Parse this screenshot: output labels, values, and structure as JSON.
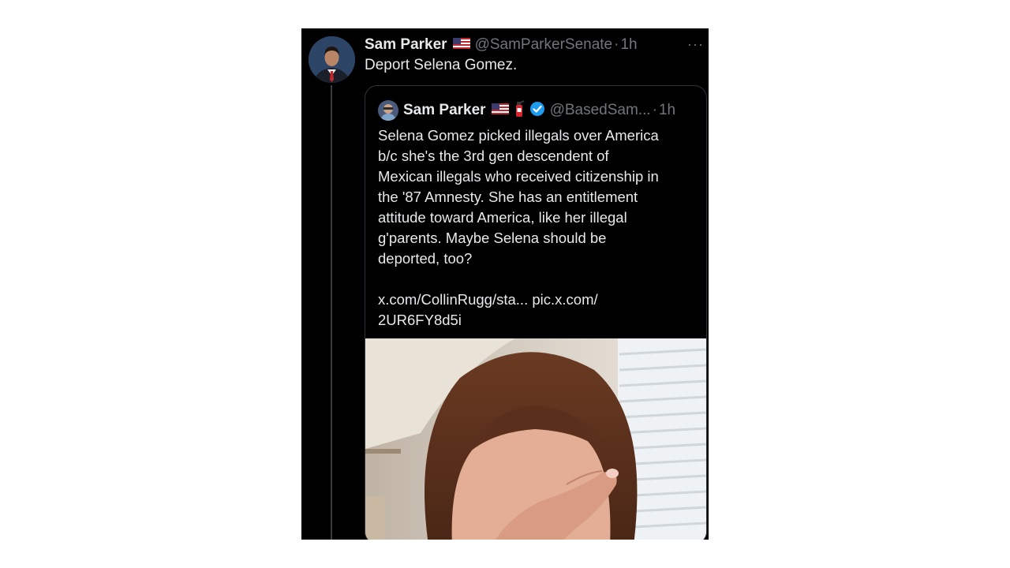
{
  "tweet": {
    "author_name": "Sam Parker",
    "author_flag_icon": "us-flag-icon",
    "handle": "@SamParkerSenate",
    "separator": "·",
    "time": "1h",
    "more_label": "···",
    "text": "Deport Selena Gomez."
  },
  "quote": {
    "author_name": "Sam Parker",
    "icons": [
      "us-flag-icon",
      "fire-extinguisher-icon",
      "verified-badge-icon"
    ],
    "handle": "@BasedSam...",
    "separator": "·",
    "time": "1h",
    "lines": [
      "Selena Gomez picked illegals over America",
      "b/c she's the 3rd gen descendent of",
      "Mexican illegals who received citizenship in",
      "the '87 Amnesty. She has an entitlement",
      "attitude toward America, like her illegal",
      "g'parents. Maybe Selena should be",
      "deported, too?"
    ],
    "link_line_1": "x.com/CollinRugg/sta... pic.x.com/",
    "link_line_2": "2UR6FY8d5i"
  },
  "colors": {
    "background": "#000000",
    "primary_text": "#e7e9ea",
    "secondary_text": "#71767b",
    "verified_blue": "#1d9bf0",
    "border": "#2f3336"
  }
}
